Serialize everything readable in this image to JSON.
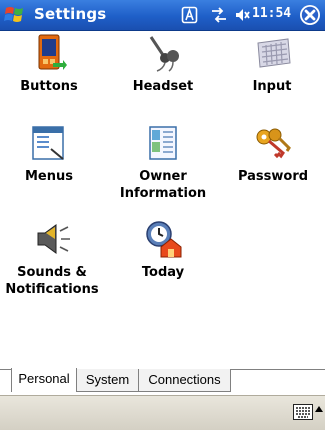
{
  "titlebar": {
    "title": "Settings",
    "clock": "11:54",
    "icons": [
      "windows-start-icon",
      "ime-icon",
      "connection-icon",
      "volume-icon",
      "close-icon"
    ]
  },
  "items": [
    {
      "label": "Buttons",
      "icon": "buttons-icon"
    },
    {
      "label": "Headset",
      "icon": "headset-icon"
    },
    {
      "label": "Input",
      "icon": "keyboard-icon"
    },
    {
      "label": "Menus",
      "icon": "menus-icon"
    },
    {
      "label": "Owner",
      "label2": "Information",
      "icon": "owner-information-icon"
    },
    {
      "label": "Password",
      "icon": "keys-icon"
    },
    {
      "label": "Sounds &",
      "label2": "Notifications",
      "icon": "speaker-icon"
    },
    {
      "label": "Today",
      "icon": "today-clock-icon"
    }
  ],
  "tabs": [
    {
      "label": "Personal",
      "active": true
    },
    {
      "label": "System",
      "active": false
    },
    {
      "label": "Connections",
      "active": false
    }
  ],
  "menubar": {
    "icons": [
      "input-panel-icon",
      "input-panel-arrow-icon"
    ]
  }
}
